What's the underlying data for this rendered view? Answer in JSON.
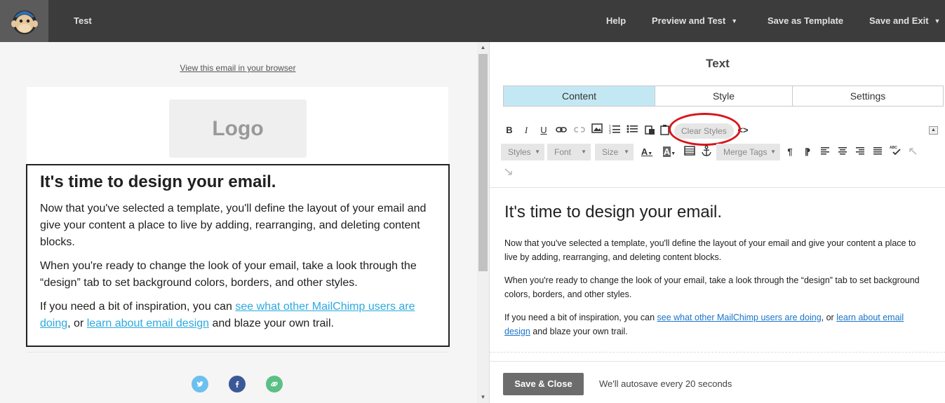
{
  "topbar": {
    "campaign_title": "Test",
    "help": "Help",
    "preview": "Preview and Test",
    "save_template": "Save as Template",
    "save_exit": "Save and Exit"
  },
  "preview": {
    "browser_link": "View this email in your browser",
    "logo_text": "Logo",
    "heading": "It's time to design your email.",
    "p1": "Now that you've selected a template, you'll define the layout of your email and give your content a place to live by adding, rearranging, and deleting content blocks.",
    "p2": "When you're ready to change the look of your email, take a look through the “design” tab to set background colors, borders, and other styles.",
    "p3_pre": "If you need a bit of inspiration, you can ",
    "p3_link1": "see what other MailChimp users are doing",
    "p3_mid": ", or ",
    "p3_link2": "learn about email design",
    "p3_post": " and blaze your own trail."
  },
  "editor": {
    "panel_title": "Text",
    "tabs": [
      "Content",
      "Style",
      "Settings"
    ],
    "toolbar": {
      "clear_styles": "Clear Styles",
      "styles": "Styles",
      "font": "Font",
      "size": "Size",
      "merge_tags": "Merge Tags"
    },
    "heading": "It's time to design your email.",
    "p1": "Now that you've selected a template, you'll define the layout of your email and give your content a place to live by adding, rearranging, and deleting content blocks.",
    "p2": "When you're ready to change the look of your email, take a look through the “design” tab to set background colors, borders, and other styles.",
    "p3_pre": "If you need a bit of inspiration, you can ",
    "p3_link1": "see what other MailChimp users are doing",
    "p3_mid": ", or ",
    "p3_link2": "learn about email design",
    "p3_post": " and blaze your own trail.",
    "save_close": "Save & Close",
    "autosave": "We'll autosave every 20 seconds"
  },
  "colors": {
    "topbar_bg": "#3c3c3c",
    "active_tab": "#c4e8f3",
    "link_preview": "#2baadf",
    "link_editor": "#1a73c8",
    "annotation": "#d9141a"
  },
  "icons": [
    "mailchimp-logo-icon",
    "twitter-icon",
    "facebook-icon",
    "link-icon"
  ]
}
